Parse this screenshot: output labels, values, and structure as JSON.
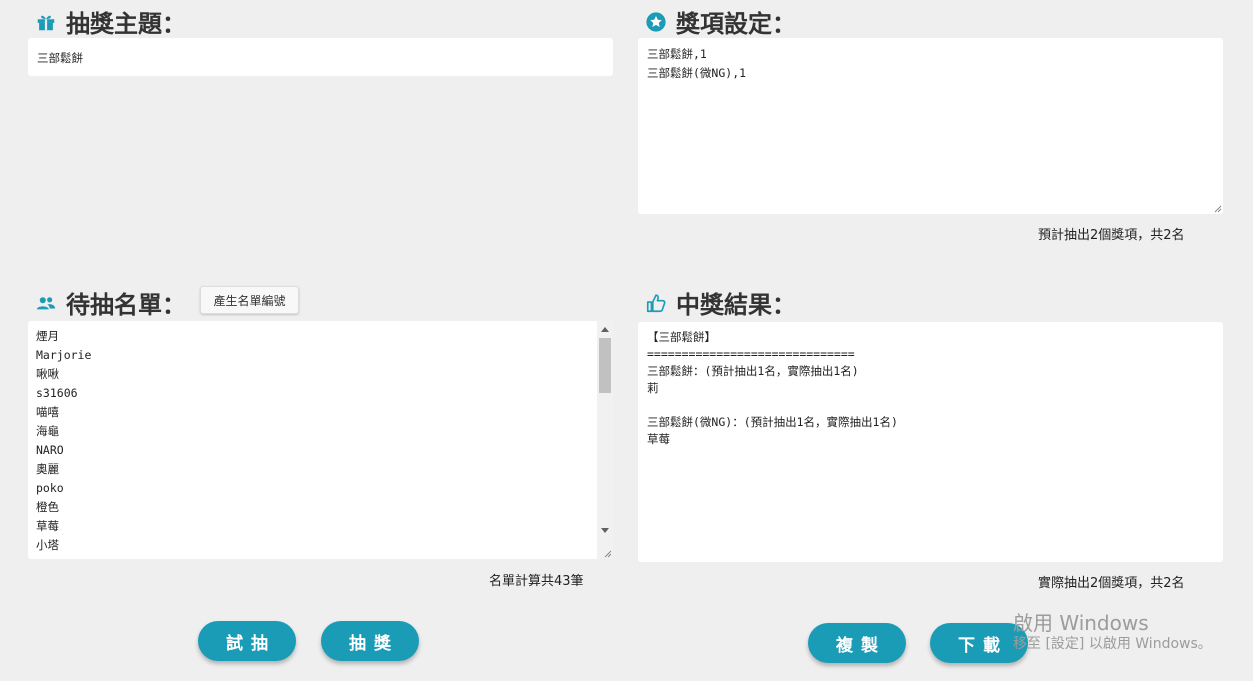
{
  "theme": {
    "heading": "抽獎主題：",
    "value": "三部鬆餅"
  },
  "prizes": {
    "heading": "獎項設定：",
    "lines": [
      "三部鬆餅,1",
      "三部鬆餅(微NG),1"
    ],
    "hint": "預計抽出2個獎項，共2名"
  },
  "candidates": {
    "heading": "待抽名單：",
    "generate_button": "產生名單編號",
    "lines": [
      "煙月",
      "Marjorie",
      "啾啾",
      "s31606",
      "喵嘻",
      "海龜",
      "NARO",
      "奧麗",
      "poko",
      "橙色",
      "草莓",
      "小塔"
    ],
    "hint": "名單計算共43筆"
  },
  "results": {
    "heading": "中獎結果：",
    "lines": [
      "【三部鬆餅】",
      "==============================",
      "三部鬆餅：(預計抽出1名，實際抽出1名)",
      "莉",
      "",
      "三部鬆餅(微NG)：(預計抽出1名，實際抽出1名)",
      "草莓"
    ],
    "hint": "實際抽出2個獎項，共2名"
  },
  "buttons": {
    "trial": "試抽",
    "draw": "抽獎",
    "copy": "複製",
    "download": "下載"
  },
  "watermark": {
    "title": "啟用 Windows",
    "subtitle": "移至 [設定] 以啟用 Windows。"
  },
  "colors": {
    "accent": "#1b9cb6",
    "background": "#efefef"
  },
  "icons": [
    "gift-icon",
    "star-circle-icon",
    "users-icon",
    "thumbs-up-icon"
  ]
}
